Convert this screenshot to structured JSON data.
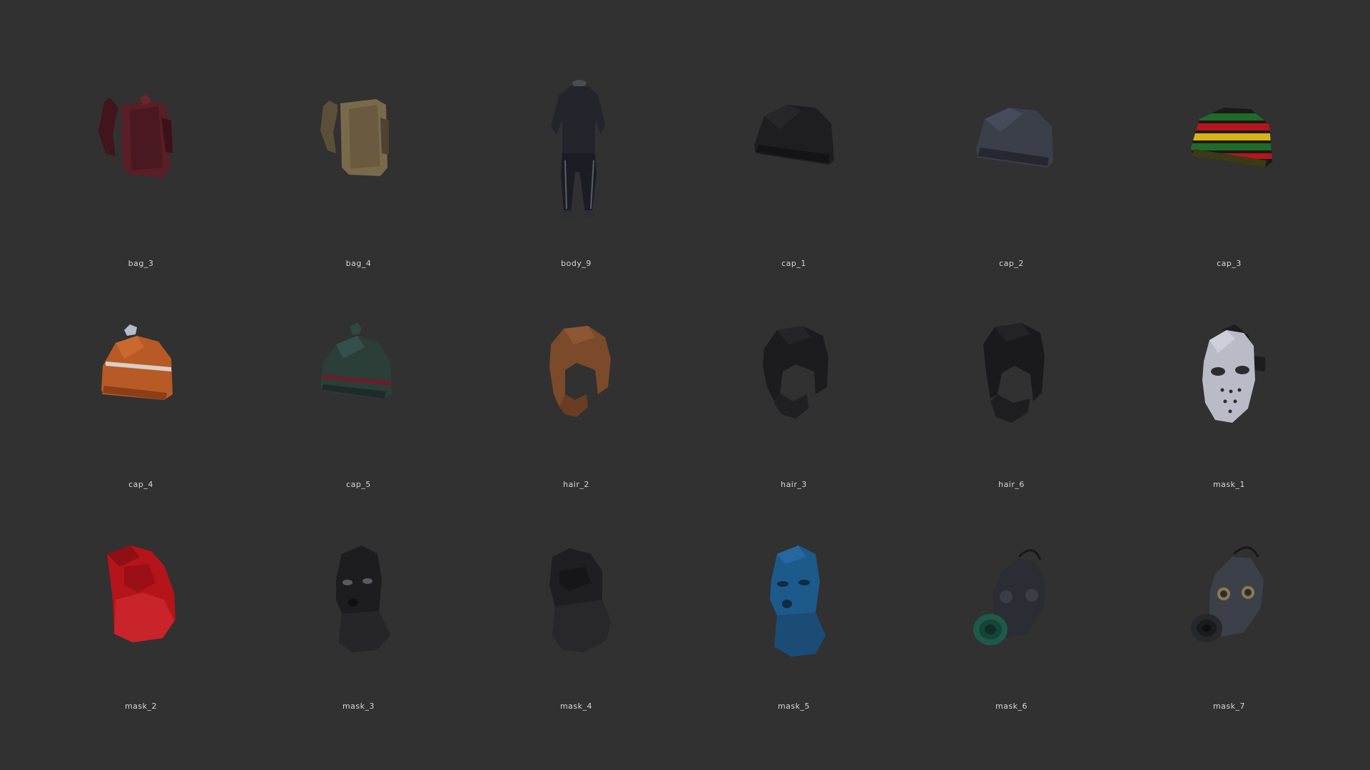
{
  "items": [
    {
      "label": "bag_3",
      "icon": "backpack-icon",
      "color": "#5a1e27"
    },
    {
      "label": "bag_4",
      "icon": "backpack-icon",
      "color": "#7a6a4c"
    },
    {
      "label": "body_9",
      "icon": "tracksuit-icon",
      "color": "#23242c"
    },
    {
      "label": "cap_1",
      "icon": "beanie-icon",
      "color": "#1e1e20"
    },
    {
      "label": "cap_2",
      "icon": "beanie-icon",
      "color": "#3a3f4a"
    },
    {
      "label": "cap_3",
      "icon": "striped-beanie-icon",
      "color": "#1f6b2a"
    },
    {
      "label": "cap_4",
      "icon": "pom-beanie-icon",
      "color": "#b85a25"
    },
    {
      "label": "cap_5",
      "icon": "pom-beanie-icon",
      "color": "#2b3e38"
    },
    {
      "label": "hair_2",
      "icon": "hair-beard-icon",
      "color": "#7a4a2a"
    },
    {
      "label": "hair_3",
      "icon": "hair-beard-icon",
      "color": "#1c1c1e"
    },
    {
      "label": "hair_6",
      "icon": "hair-beard-icon",
      "color": "#1a1a1c"
    },
    {
      "label": "mask_1",
      "icon": "hockey-mask-icon",
      "color": "#b9bcc6"
    },
    {
      "label": "mask_2",
      "icon": "hood-mask-icon",
      "color": "#b5141a"
    },
    {
      "label": "mask_3",
      "icon": "balaclava-icon",
      "color": "#1d1d1f"
    },
    {
      "label": "mask_4",
      "icon": "balaclava-icon",
      "color": "#1f1f21"
    },
    {
      "label": "mask_5",
      "icon": "balaclava-icon",
      "color": "#1d5a8c"
    },
    {
      "label": "mask_6",
      "icon": "gas-mask-icon",
      "color": "#2a2d33"
    },
    {
      "label": "mask_7",
      "icon": "gas-mask-icon",
      "color": "#3c4048"
    }
  ]
}
